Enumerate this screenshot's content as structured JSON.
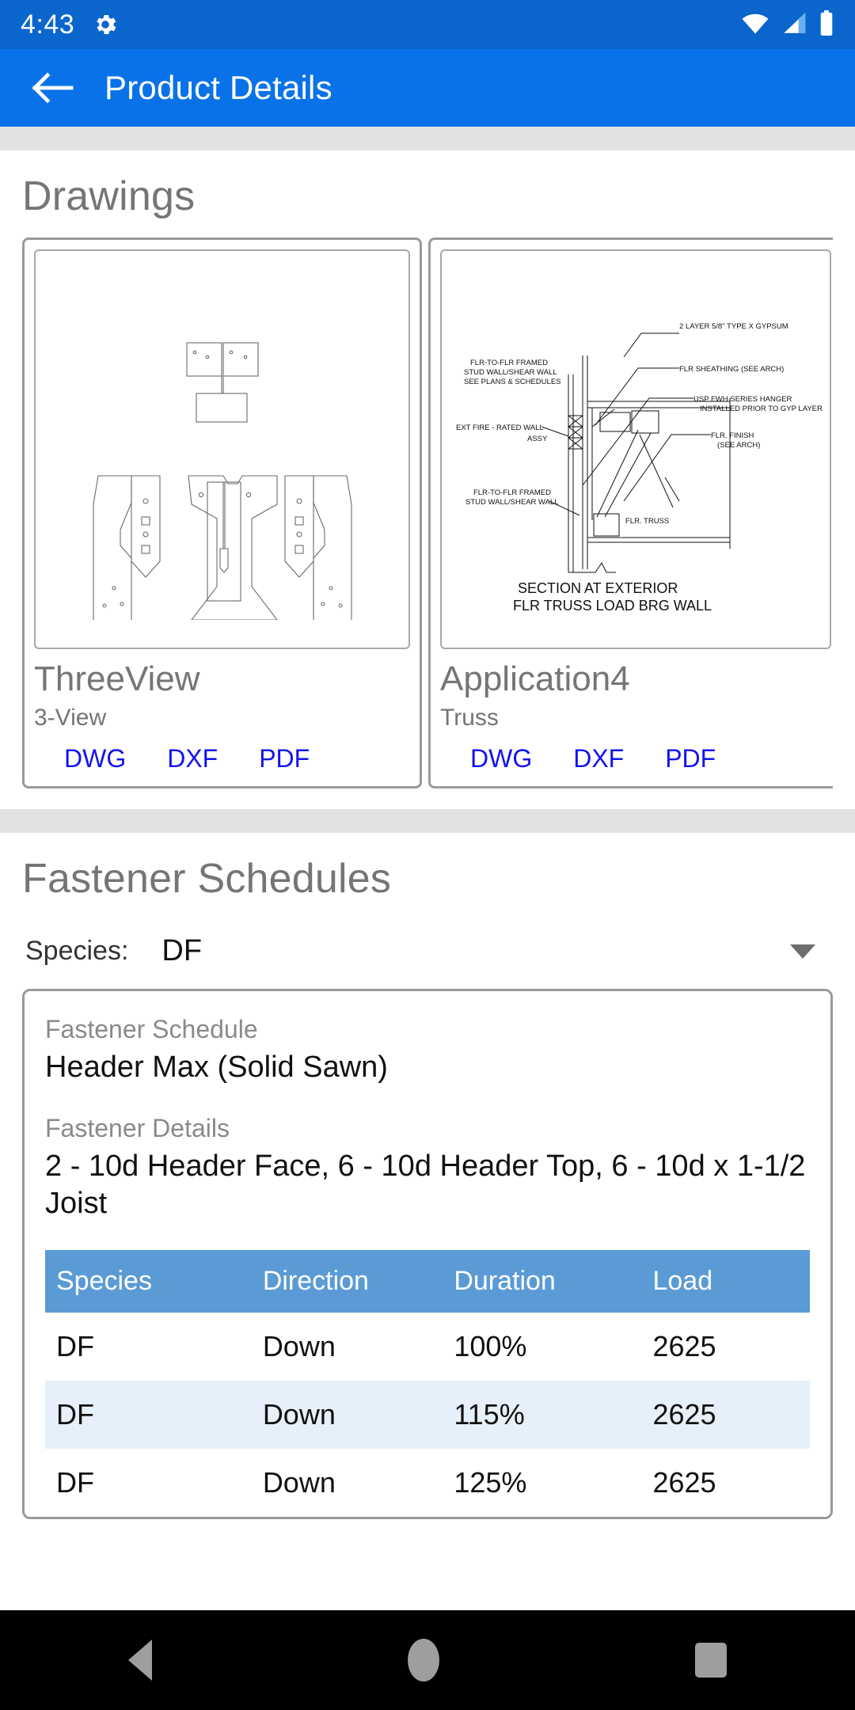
{
  "status_bar": {
    "time": "4:43",
    "icons": [
      "gear-icon",
      "wifi-icon",
      "signal-icon",
      "battery-icon"
    ],
    "bg_color": "#0a66cc"
  },
  "app_bar": {
    "title": "Product Details",
    "back_icon": "arrow-left-icon",
    "bg_color": "#0a72e8"
  },
  "sections": {
    "drawings": {
      "title": "Drawings",
      "cards": [
        {
          "title": "ThreeView",
          "subtitle": "3-View",
          "links": [
            "DWG",
            "DXF",
            "PDF"
          ],
          "thumb_kind": "three-view-hanger"
        },
        {
          "title": "Application4",
          "subtitle": "Truss",
          "links": [
            "DWG",
            "DXF",
            "PDF"
          ],
          "thumb_kind": "section-detail",
          "thumb_caption_line1": "SECTION AT EXTERIOR",
          "thumb_caption_line2": "FLR TRUSS LOAD BRG WALL",
          "thumb_annotations": [
            "2 LAYER 5/8\" TYPE X GYPSUM",
            "FLR SHEATHING (SEE ARCH)",
            "USP FWH SERIES HANGER",
            "INSTALLED PRIOR TO GYP LAYER",
            "FLR. FINISH",
            "(SEE ARCH)",
            "FLR-TO-FLR FRAMED",
            "STUD WALL/SHEAR WALL",
            "SEE PLANS & SCHEDULES",
            "EXT FIRE - RATED WALL",
            "ASSY",
            "FLR. TRUSS"
          ]
        }
      ]
    },
    "fastener_schedules": {
      "title": "Fastener Schedules",
      "species_filter": {
        "label": "Species:",
        "value": "DF",
        "caret_icon": "chevron-down-icon"
      },
      "card": {
        "schedule_label": "Fastener Schedule",
        "schedule_value": "Header Max (Solid Sawn)",
        "details_label": "Fastener Details",
        "details_value": "2 - 10d Header Face,  6 - 10d Header Top,  6 - 10d x 1-1/2 Joist",
        "table": {
          "headers": [
            "Species",
            "Direction",
            "Duration",
            "Load"
          ],
          "header_bg": "#5b9bd5",
          "alt_row_bg": "#e6f0fa",
          "rows": [
            [
              "DF",
              "Down",
              "100%",
              "2625"
            ],
            [
              "DF",
              "Down",
              "115%",
              "2625"
            ],
            [
              "DF",
              "Down",
              "125%",
              "2625"
            ]
          ]
        }
      }
    }
  },
  "nav_bar": {
    "items": [
      "back-icon",
      "home-icon",
      "recents-icon"
    ],
    "bg_color": "#000000"
  }
}
